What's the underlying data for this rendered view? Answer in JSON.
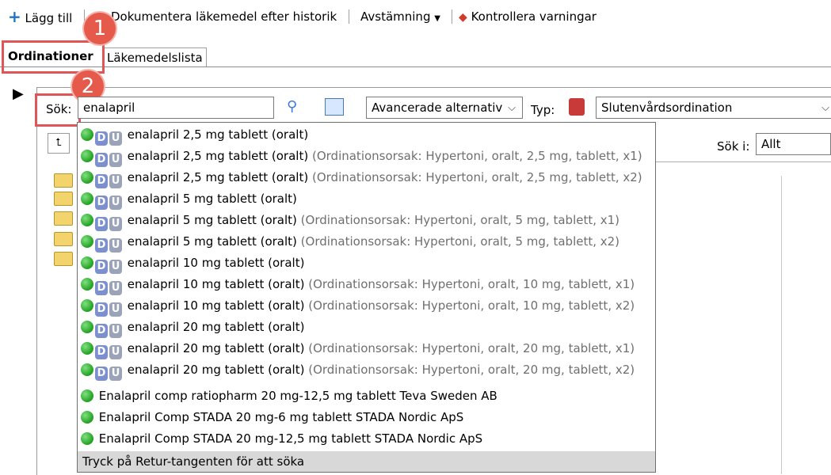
{
  "toolbar": {
    "add_label": "Lägg till",
    "document_label": "Dokumentera läkemedel efter historik",
    "reconcile_label": "Avstämning",
    "warnings_label": "Kontrollera varningar"
  },
  "tabs": [
    {
      "label": "Ordinationer"
    },
    {
      "label": "Läkemedelslista"
    }
  ],
  "callouts": [
    "1",
    "2"
  ],
  "search": {
    "label": "Sök:",
    "value": "enalapril",
    "advanced_label": "Avancerade alternativ",
    "type_label": "Typ:",
    "type_value": "Slutenvårdsordination",
    "search_in_label": "Sök i:",
    "search_in_value": "Allt"
  },
  "results": {
    "items": [
      {
        "name": "enalapril 2,5 mg tablett (oralt)",
        "reason": ""
      },
      {
        "name": "enalapril 2,5 mg tablett (oralt)",
        "reason": "(Ordinationsorsak: Hypertoni, oralt, 2,5 mg, tablett, x1)"
      },
      {
        "name": "enalapril 2,5 mg tablett (oralt)",
        "reason": "(Ordinationsorsak: Hypertoni, oralt, 2,5 mg, tablett, x2)"
      },
      {
        "name": "enalapril 5 mg tablett (oralt)",
        "reason": ""
      },
      {
        "name": "enalapril 5 mg tablett (oralt)",
        "reason": "(Ordinationsorsak: Hypertoni, oralt, 5 mg, tablett, x1)"
      },
      {
        "name": "enalapril 5 mg tablett (oralt)",
        "reason": "(Ordinationsorsak: Hypertoni, oralt, 5 mg, tablett, x2)"
      },
      {
        "name": "enalapril 10 mg tablett (oralt)",
        "reason": ""
      },
      {
        "name": "enalapril 10 mg tablett (oralt)",
        "reason": "(Ordinationsorsak: Hypertoni, oralt, 10 mg, tablett, x1)"
      },
      {
        "name": "enalapril 10 mg tablett (oralt)",
        "reason": "(Ordinationsorsak: Hypertoni, oralt, 10 mg, tablett, x2)"
      },
      {
        "name": "enalapril 20 mg tablett (oralt)",
        "reason": ""
      },
      {
        "name": "enalapril 20 mg tablett (oralt)",
        "reason": "(Ordinationsorsak: Hypertoni, oralt, 20 mg, tablett, x1)"
      },
      {
        "name": "enalapril 20 mg tablett (oralt)",
        "reason": "(Ordinationsorsak: Hypertoni, oralt, 20 mg, tablett, x2)"
      }
    ],
    "products": [
      "Enalapril comp ratiopharm 20 mg-12,5 mg tablett Teva Sweden AB",
      "Enalapril Comp STADA 20 mg-6 mg tablett STADA Nordic ApS",
      "Enalapril Comp STADA 20 mg-12,5 mg tablett STADA Nordic ApS"
    ],
    "badge_d": "D",
    "badge_u": "U",
    "footer": "Tryck på Retur-tangenten för att söka"
  }
}
